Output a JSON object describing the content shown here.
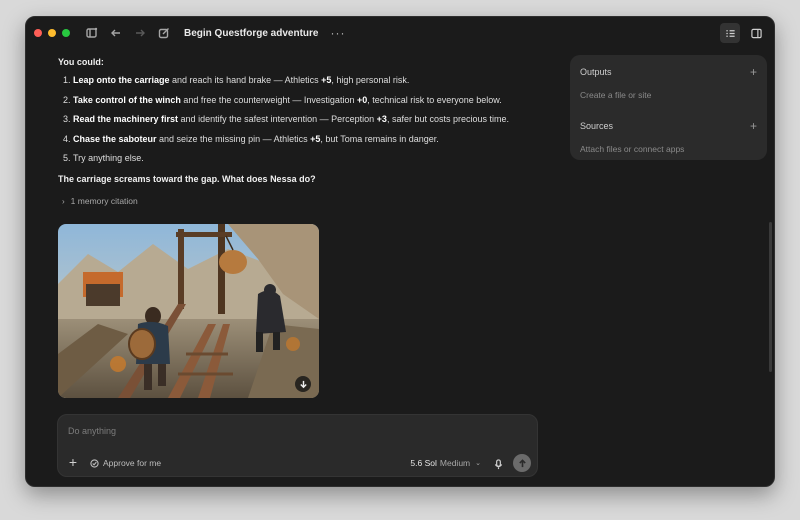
{
  "window": {
    "title": "Begin Questforge adventure",
    "more": "···"
  },
  "traffic_lights": {
    "close": "#ff5f57",
    "minimize": "#febc2e",
    "zoom": "#28c840"
  },
  "message": {
    "lead": "You could:",
    "options": [
      {
        "bold": "Leap onto the carriage",
        "rest": " and reach its hand brake — Athletics ",
        "mod": "+5",
        "tail": ", high personal risk."
      },
      {
        "bold": "Take control of the winch",
        "rest": " and free the counterweight — Investigation ",
        "mod": "+0",
        "tail": ", technical risk to everyone below."
      },
      {
        "bold": "Read the machinery first",
        "rest": " and identify the safest intervention — Perception ",
        "mod": "+3",
        "tail": ", safer but costs precious time."
      },
      {
        "bold": "Chase the saboteur",
        "rest": " and seize the missing pin — Athletics ",
        "mod": "+5",
        "tail": ", but Toma remains in danger."
      },
      {
        "bold": "",
        "rest": "Try anything else.",
        "mod": "",
        "tail": ""
      }
    ],
    "question": "The carriage screams toward the gap. What does Nessa do?",
    "memory": "1 memory citation"
  },
  "composer": {
    "placeholder": "Do anything",
    "approve": "Approve for me",
    "model": "5.6 Sol",
    "effort": "Medium"
  },
  "panel": {
    "outputs": {
      "title": "Outputs",
      "hint": "Create a file or site"
    },
    "sources": {
      "title": "Sources",
      "hint": "Attach files or connect apps"
    }
  }
}
